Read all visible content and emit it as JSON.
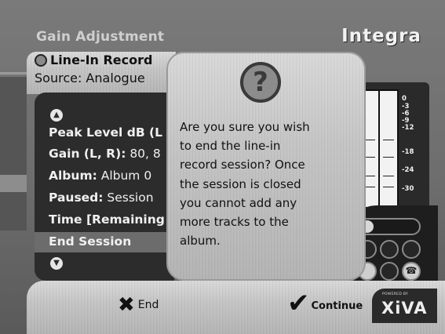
{
  "header": {
    "title": "Gain Adjustment",
    "brand": "Integra"
  },
  "record": {
    "title": "Line-In Record",
    "source": "Source: Analogue"
  },
  "list": {
    "items": [
      {
        "label": "Peak Level dB (L",
        "value": ""
      },
      {
        "label": "Gain (L, R):",
        "value": " 80, 8"
      },
      {
        "label": "Album:",
        "value": " Album 0"
      },
      {
        "label": "Paused:",
        "value": " Session"
      },
      {
        "label": "Time [Remaining",
        "value": ""
      },
      {
        "label": "End Session",
        "value": ""
      }
    ],
    "selected_index": 5
  },
  "meter": {
    "scale": [
      "0",
      "-3",
      "-6",
      "-9",
      "-12",
      "-18",
      "-24",
      "-30"
    ]
  },
  "dialog": {
    "icon": "question-icon",
    "lines": [
      "Are you sure you wish",
      "to end the line-in",
      "record session? Once",
      "the session is closed",
      "you cannot add any",
      "more tracks to the",
      "album."
    ]
  },
  "footer": {
    "end_label": "End",
    "continue_label": "Continue",
    "powered_by": "POWERED BY",
    "logo": "XiVA"
  }
}
